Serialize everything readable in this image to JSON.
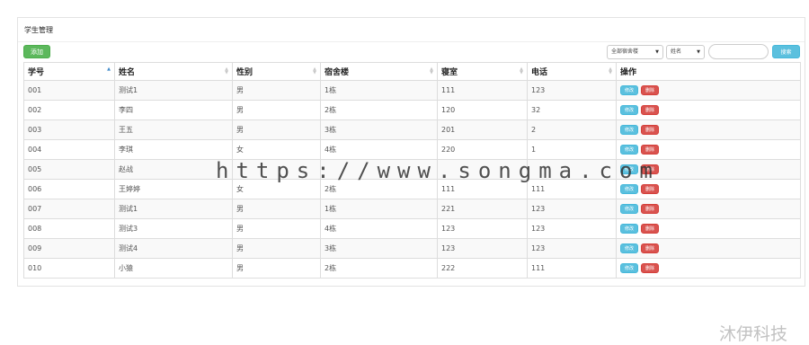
{
  "panel": {
    "title": "学生管理"
  },
  "toolbar": {
    "add_label": "添加",
    "dorm_select": "全部宿舍楼",
    "field_select": "姓名",
    "search_value": "",
    "search_label": "搜索"
  },
  "table": {
    "columns": [
      "学号",
      "姓名",
      "性别",
      "宿舍楼",
      "寝室",
      "电话",
      "操作"
    ],
    "sorted_column": "学号",
    "rows": [
      [
        "001",
        "测试1",
        "男",
        "1栋",
        "111",
        "123"
      ],
      [
        "002",
        "李四",
        "男",
        "2栋",
        "120",
        "32"
      ],
      [
        "003",
        "王五",
        "男",
        "3栋",
        "201",
        "2"
      ],
      [
        "004",
        "李琪",
        "女",
        "4栋",
        "220",
        "1"
      ],
      [
        "005",
        "赵战",
        "",
        "",
        "",
        ""
      ],
      [
        "006",
        "王婷婷",
        "女",
        "2栋",
        "111",
        "111"
      ],
      [
        "007",
        "测试1",
        "男",
        "1栋",
        "221",
        "123"
      ],
      [
        "008",
        "测试3",
        "男",
        "4栋",
        "123",
        "123"
      ],
      [
        "009",
        "测试4",
        "男",
        "3栋",
        "123",
        "123"
      ],
      [
        "010",
        "小猿",
        "男",
        "2栋",
        "222",
        "111"
      ]
    ],
    "edit_label": "修改",
    "delete_label": "删除"
  },
  "watermark": "https://www.songma.com",
  "corner_logo": "沐伊科技",
  "colors": {
    "add_button": "#5cb85c",
    "search_button": "#5bc0de",
    "edit_button": "#5bc0de",
    "delete_button": "#d9534f",
    "sort_active": "#428bca"
  }
}
